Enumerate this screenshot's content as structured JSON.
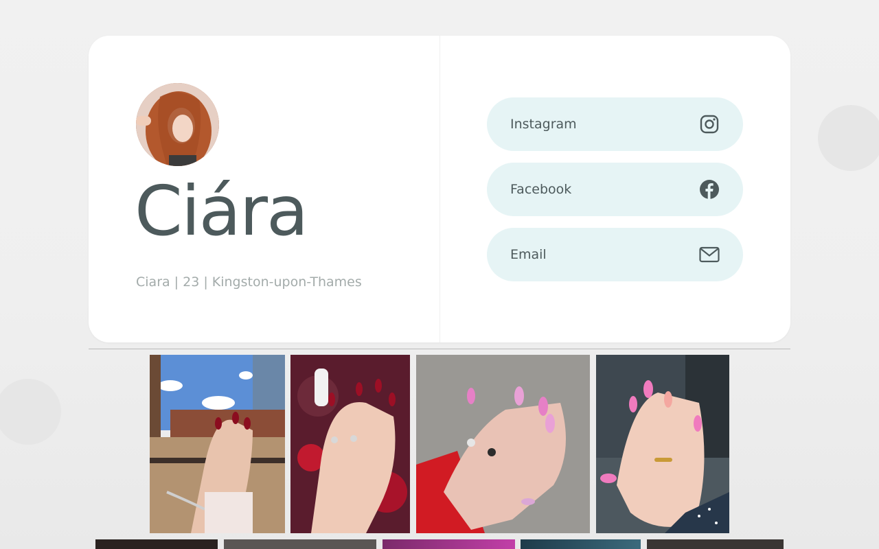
{
  "profile": {
    "name": "Ciára",
    "bio": "Ciara | 23 | Kingston-upon-Thames",
    "avatar_alt": "profile photo"
  },
  "links": [
    {
      "label": "Instagram",
      "icon": "instagram-icon"
    },
    {
      "label": "Facebook",
      "icon": "facebook-icon"
    },
    {
      "label": "Email",
      "icon": "mail-icon"
    }
  ],
  "gallery": {
    "row1": [
      "photo-red-nails-city",
      "photo-red-nails-tree",
      "photo-pink-swirl-nails",
      "photo-pink-nails-car"
    ],
    "row2": [
      "photo-6",
      "photo-7",
      "photo-8",
      "photo-9",
      "photo-10"
    ]
  },
  "colors": {
    "accent_button_bg": "#e6f4f5",
    "text_primary": "#4d5a5c",
    "text_muted": "#a3abaa"
  }
}
